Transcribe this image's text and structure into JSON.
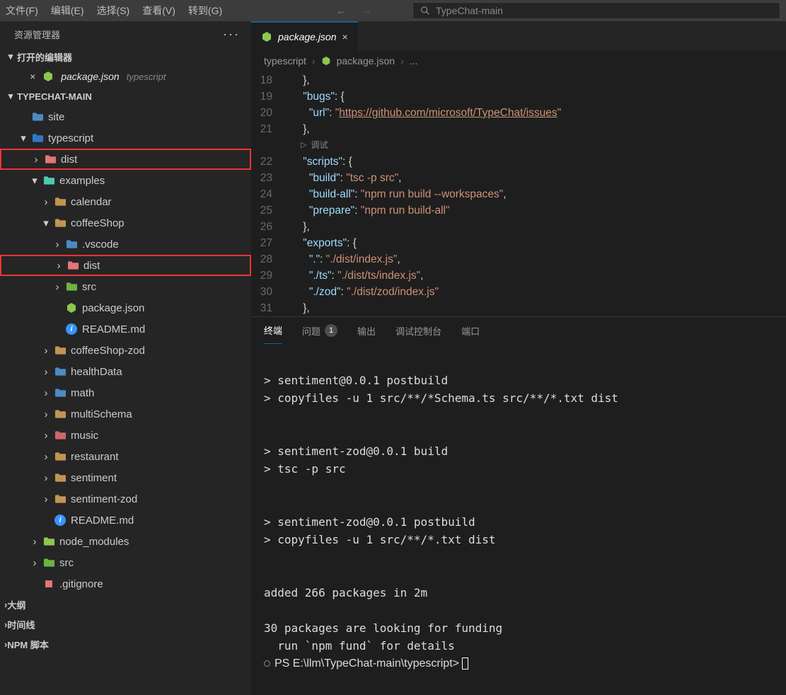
{
  "menubar": {
    "items": [
      "文件(F)",
      "编辑(E)",
      "选择(S)",
      "查看(V)",
      "转到(G)"
    ],
    "search_placeholder": "TypeChat-main"
  },
  "sidebar": {
    "title": "资源管理器",
    "open_editors_label": "打开的编辑器",
    "open_editor": {
      "file": "package.json",
      "folder": "typescript"
    },
    "project": "TYPECHAT-MAIN",
    "tree": [
      {
        "d": 1,
        "chev": "",
        "icon": "folder-blue",
        "name": "site"
      },
      {
        "d": 1,
        "chev": "v",
        "icon": "folder-ts",
        "name": "typescript"
      },
      {
        "d": 2,
        "chev": ">",
        "icon": "dist",
        "name": "dist",
        "red": true
      },
      {
        "d": 2,
        "chev": "v",
        "icon": "teal-open",
        "name": "examples"
      },
      {
        "d": 3,
        "chev": ">",
        "icon": "folder",
        "name": "calendar"
      },
      {
        "d": 3,
        "chev": "v",
        "icon": "folder-open",
        "name": "coffeeShop"
      },
      {
        "d": 4,
        "chev": ">",
        "icon": "folder-blue",
        "name": ".vscode"
      },
      {
        "d": 4,
        "chev": ">",
        "icon": "dist",
        "name": "dist",
        "red": true
      },
      {
        "d": 4,
        "chev": ">",
        "icon": "src",
        "name": "src"
      },
      {
        "d": 4,
        "chev": "",
        "icon": "nodejs",
        "name": "package.json"
      },
      {
        "d": 4,
        "chev": "",
        "icon": "info",
        "name": "README.md"
      },
      {
        "d": 3,
        "chev": ">",
        "icon": "folder",
        "name": "coffeeShop-zod"
      },
      {
        "d": 3,
        "chev": ">",
        "icon": "folder-blue",
        "name": "healthData"
      },
      {
        "d": 3,
        "chev": ">",
        "icon": "folder-blue",
        "name": "math"
      },
      {
        "d": 3,
        "chev": ">",
        "icon": "folder",
        "name": "multiSchema"
      },
      {
        "d": 3,
        "chev": ">",
        "icon": "folder-red",
        "name": "music"
      },
      {
        "d": 3,
        "chev": ">",
        "icon": "folder",
        "name": "restaurant"
      },
      {
        "d": 3,
        "chev": ">",
        "icon": "folder",
        "name": "sentiment"
      },
      {
        "d": 3,
        "chev": ">",
        "icon": "folder",
        "name": "sentiment-zod"
      },
      {
        "d": 3,
        "chev": "",
        "icon": "info",
        "name": "README.md"
      },
      {
        "d": 2,
        "chev": ">",
        "icon": "node_modules",
        "name": "node_modules"
      },
      {
        "d": 2,
        "chev": ">",
        "icon": "src",
        "name": "src"
      },
      {
        "d": 2,
        "chev": "",
        "icon": "gitignore",
        "name": ".gitignore"
      }
    ],
    "extra_sections": [
      "大纲",
      "时间线",
      "NPM 脚本"
    ]
  },
  "tab": {
    "name": "package.json"
  },
  "breadcrumb": {
    "parts": [
      "typescript",
      "package.json"
    ],
    "dots": "..."
  },
  "code": {
    "lines": [
      {
        "n": 18,
        "t": [
          "p",
          "    },"
        ]
      },
      {
        "n": 19,
        "t": [
          "p",
          "    ",
          "k",
          "\"bugs\"",
          "p",
          ": ",
          "b",
          "{"
        ]
      },
      {
        "n": 20,
        "t": [
          "p",
          "      ",
          "k",
          "\"url\"",
          "p",
          ": ",
          "s",
          "\"",
          "slink",
          "https://github.com/microsoft/TypeChat/issues",
          "s",
          "\""
        ]
      },
      {
        "n": 21,
        "t": [
          "p",
          "    ",
          "b",
          "}",
          "p",
          ","
        ]
      },
      {
        "n": -1,
        "codelens": "调试"
      },
      {
        "n": 22,
        "t": [
          "p",
          "    ",
          "k",
          "\"scripts\"",
          "p",
          ": ",
          "b",
          "{"
        ]
      },
      {
        "n": 23,
        "t": [
          "p",
          "      ",
          "k",
          "\"build\"",
          "p",
          ": ",
          "s",
          "\"tsc -p src\"",
          "p",
          ","
        ]
      },
      {
        "n": 24,
        "t": [
          "p",
          "      ",
          "k",
          "\"build-all\"",
          "p",
          ": ",
          "s",
          "\"npm run build --workspaces\"",
          "p",
          ","
        ]
      },
      {
        "n": 25,
        "t": [
          "p",
          "      ",
          "k",
          "\"prepare\"",
          "p",
          ": ",
          "s",
          "\"npm run build-all\""
        ]
      },
      {
        "n": 26,
        "t": [
          "p",
          "    ",
          "b",
          "}",
          "p",
          ","
        ]
      },
      {
        "n": 27,
        "t": [
          "p",
          "    ",
          "k",
          "\"exports\"",
          "p",
          ": ",
          "b",
          "{"
        ]
      },
      {
        "n": 28,
        "t": [
          "p",
          "      ",
          "k",
          "\".\"",
          "p",
          ": ",
          "s",
          "\"./dist/index.js\"",
          "p",
          ","
        ]
      },
      {
        "n": 29,
        "t": [
          "p",
          "      ",
          "k",
          "\"./ts\"",
          "p",
          ": ",
          "s",
          "\"./dist/ts/index.js\"",
          "p",
          ","
        ]
      },
      {
        "n": 30,
        "t": [
          "p",
          "      ",
          "k",
          "\"./zod\"",
          "p",
          ": ",
          "s",
          "\"./dist/zod/index.js\""
        ]
      },
      {
        "n": 31,
        "t": [
          "p",
          "    ",
          "b",
          "}",
          "p",
          ","
        ]
      }
    ]
  },
  "panel": {
    "tabs": [
      {
        "label": "终端",
        "active": true
      },
      {
        "label": "问题",
        "badge": "1"
      },
      {
        "label": "输出"
      },
      {
        "label": "调试控制台"
      },
      {
        "label": "端口"
      }
    ],
    "term_lines": [
      "",
      "> sentiment@0.0.1 postbuild",
      "> copyfiles -u 1 src/**/*Schema.ts src/**/*.txt dist",
      "",
      "",
      "> sentiment-zod@0.0.1 build",
      "> tsc -p src",
      "",
      "",
      "> sentiment-zod@0.0.1 postbuild",
      "> copyfiles -u 1 src/**/*.txt dist",
      "",
      "",
      "added 266 packages in 2m",
      "",
      "30 packages are looking for funding",
      "  run `npm fund` for details"
    ],
    "prompt": "PS E:\\llm\\TypeChat-main\\typescript> "
  }
}
